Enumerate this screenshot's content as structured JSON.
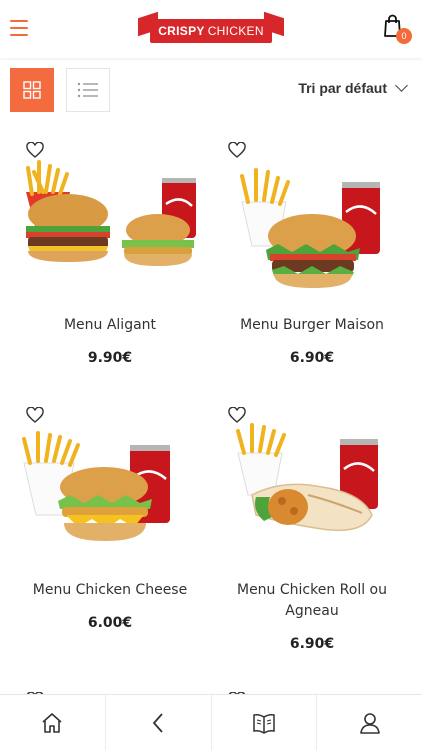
{
  "header": {
    "logo_word1": "CRISPY",
    "logo_word2": "CHICKEN",
    "cart_count": "0"
  },
  "toolbar": {
    "sort_label": "Tri par défaut"
  },
  "products": [
    {
      "name": "Menu Aligant",
      "price": "9.90€"
    },
    {
      "name": "Menu Burger Maison",
      "price": "6.90€"
    },
    {
      "name": "Menu Chicken Cheese",
      "price": "6.00€"
    },
    {
      "name": "Menu Chicken Roll ou Agneau",
      "price": "6.90€"
    }
  ],
  "icons": {
    "menu": "hamburger-menu-icon",
    "cart": "shopping-bag-icon",
    "grid_view": "grid-icon",
    "list_view": "list-icon",
    "favorite": "heart-icon",
    "home": "home-icon",
    "back": "chevron-left-icon",
    "catalog": "book-icon",
    "account": "user-icon"
  },
  "colors": {
    "accent": "#f26b3a",
    "brand_red": "#d7272b"
  }
}
